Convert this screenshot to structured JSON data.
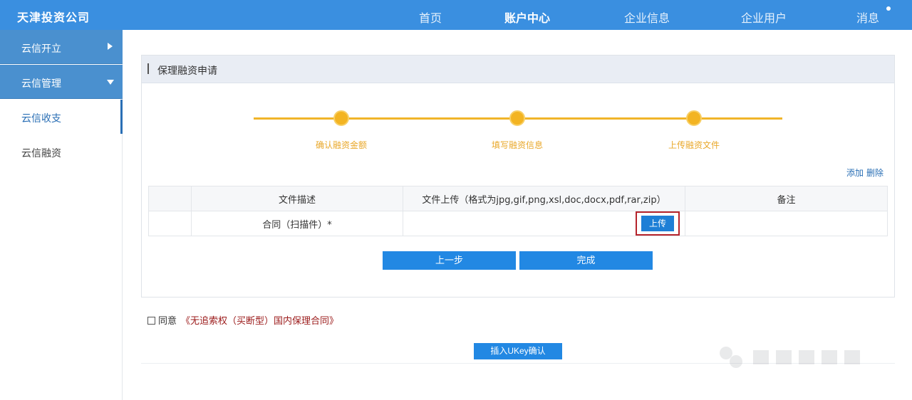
{
  "app": {
    "brand": "天津投资公司"
  },
  "nav": {
    "home": "首页",
    "account": "账户中心",
    "company": "企业信息",
    "users": "企业用户",
    "messages": "消息"
  },
  "sidebar": {
    "open": "云信开立",
    "manage": "云信管理",
    "receive": "云信收支",
    "finance": "云信融资"
  },
  "panel": {
    "title": "保理融资申请"
  },
  "steps": [
    {
      "label": "确认融资金额"
    },
    {
      "label": "填写融资信息"
    },
    {
      "label": "上传融资文件"
    }
  ],
  "table_actions": {
    "add": "添加",
    "delete": "删除"
  },
  "table": {
    "headers": [
      "",
      "文件描述",
      "文件上传（格式为jpg,gif,png,xsl,doc,docx,pdf,rar,zip）",
      "备注"
    ],
    "rows": [
      {
        "index": "",
        "description": "合同（扫描件）*",
        "upload_label": "上传",
        "note": ""
      }
    ]
  },
  "buttons": {
    "prev": "上一步",
    "done": "完成",
    "ukey": "插入UKey确认"
  },
  "agreement": {
    "label": "同意",
    "link": "《无追索权（买断型）国内保理合同》"
  }
}
